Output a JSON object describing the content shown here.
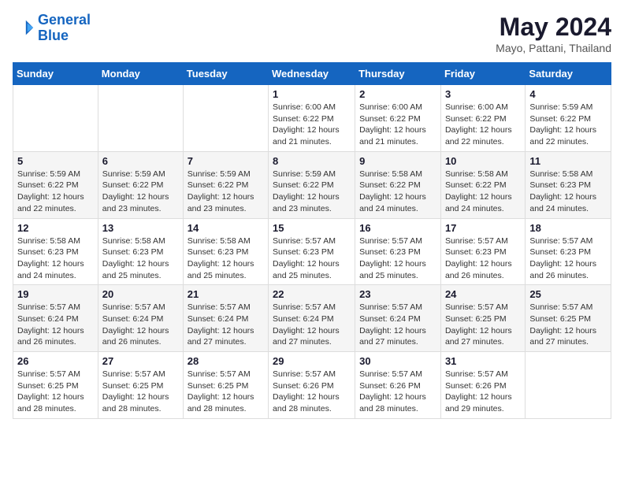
{
  "header": {
    "logo_line1": "General",
    "logo_line2": "Blue",
    "main_title": "May 2024",
    "subtitle": "Mayo, Pattani, Thailand"
  },
  "weekdays": [
    "Sunday",
    "Monday",
    "Tuesday",
    "Wednesday",
    "Thursday",
    "Friday",
    "Saturday"
  ],
  "weeks": [
    [
      {
        "day": "",
        "info": ""
      },
      {
        "day": "",
        "info": ""
      },
      {
        "day": "",
        "info": ""
      },
      {
        "day": "1",
        "info": "Sunrise: 6:00 AM\nSunset: 6:22 PM\nDaylight: 12 hours\nand 21 minutes."
      },
      {
        "day": "2",
        "info": "Sunrise: 6:00 AM\nSunset: 6:22 PM\nDaylight: 12 hours\nand 21 minutes."
      },
      {
        "day": "3",
        "info": "Sunrise: 6:00 AM\nSunset: 6:22 PM\nDaylight: 12 hours\nand 22 minutes."
      },
      {
        "day": "4",
        "info": "Sunrise: 5:59 AM\nSunset: 6:22 PM\nDaylight: 12 hours\nand 22 minutes."
      }
    ],
    [
      {
        "day": "5",
        "info": "Sunrise: 5:59 AM\nSunset: 6:22 PM\nDaylight: 12 hours\nand 22 minutes."
      },
      {
        "day": "6",
        "info": "Sunrise: 5:59 AM\nSunset: 6:22 PM\nDaylight: 12 hours\nand 23 minutes."
      },
      {
        "day": "7",
        "info": "Sunrise: 5:59 AM\nSunset: 6:22 PM\nDaylight: 12 hours\nand 23 minutes."
      },
      {
        "day": "8",
        "info": "Sunrise: 5:59 AM\nSunset: 6:22 PM\nDaylight: 12 hours\nand 23 minutes."
      },
      {
        "day": "9",
        "info": "Sunrise: 5:58 AM\nSunset: 6:22 PM\nDaylight: 12 hours\nand 24 minutes."
      },
      {
        "day": "10",
        "info": "Sunrise: 5:58 AM\nSunset: 6:22 PM\nDaylight: 12 hours\nand 24 minutes."
      },
      {
        "day": "11",
        "info": "Sunrise: 5:58 AM\nSunset: 6:23 PM\nDaylight: 12 hours\nand 24 minutes."
      }
    ],
    [
      {
        "day": "12",
        "info": "Sunrise: 5:58 AM\nSunset: 6:23 PM\nDaylight: 12 hours\nand 24 minutes."
      },
      {
        "day": "13",
        "info": "Sunrise: 5:58 AM\nSunset: 6:23 PM\nDaylight: 12 hours\nand 25 minutes."
      },
      {
        "day": "14",
        "info": "Sunrise: 5:58 AM\nSunset: 6:23 PM\nDaylight: 12 hours\nand 25 minutes."
      },
      {
        "day": "15",
        "info": "Sunrise: 5:57 AM\nSunset: 6:23 PM\nDaylight: 12 hours\nand 25 minutes."
      },
      {
        "day": "16",
        "info": "Sunrise: 5:57 AM\nSunset: 6:23 PM\nDaylight: 12 hours\nand 25 minutes."
      },
      {
        "day": "17",
        "info": "Sunrise: 5:57 AM\nSunset: 6:23 PM\nDaylight: 12 hours\nand 26 minutes."
      },
      {
        "day": "18",
        "info": "Sunrise: 5:57 AM\nSunset: 6:23 PM\nDaylight: 12 hours\nand 26 minutes."
      }
    ],
    [
      {
        "day": "19",
        "info": "Sunrise: 5:57 AM\nSunset: 6:24 PM\nDaylight: 12 hours\nand 26 minutes."
      },
      {
        "day": "20",
        "info": "Sunrise: 5:57 AM\nSunset: 6:24 PM\nDaylight: 12 hours\nand 26 minutes."
      },
      {
        "day": "21",
        "info": "Sunrise: 5:57 AM\nSunset: 6:24 PM\nDaylight: 12 hours\nand 27 minutes."
      },
      {
        "day": "22",
        "info": "Sunrise: 5:57 AM\nSunset: 6:24 PM\nDaylight: 12 hours\nand 27 minutes."
      },
      {
        "day": "23",
        "info": "Sunrise: 5:57 AM\nSunset: 6:24 PM\nDaylight: 12 hours\nand 27 minutes."
      },
      {
        "day": "24",
        "info": "Sunrise: 5:57 AM\nSunset: 6:25 PM\nDaylight: 12 hours\nand 27 minutes."
      },
      {
        "day": "25",
        "info": "Sunrise: 5:57 AM\nSunset: 6:25 PM\nDaylight: 12 hours\nand 27 minutes."
      }
    ],
    [
      {
        "day": "26",
        "info": "Sunrise: 5:57 AM\nSunset: 6:25 PM\nDaylight: 12 hours\nand 28 minutes."
      },
      {
        "day": "27",
        "info": "Sunrise: 5:57 AM\nSunset: 6:25 PM\nDaylight: 12 hours\nand 28 minutes."
      },
      {
        "day": "28",
        "info": "Sunrise: 5:57 AM\nSunset: 6:25 PM\nDaylight: 12 hours\nand 28 minutes."
      },
      {
        "day": "29",
        "info": "Sunrise: 5:57 AM\nSunset: 6:26 PM\nDaylight: 12 hours\nand 28 minutes."
      },
      {
        "day": "30",
        "info": "Sunrise: 5:57 AM\nSunset: 6:26 PM\nDaylight: 12 hours\nand 28 minutes."
      },
      {
        "day": "31",
        "info": "Sunrise: 5:57 AM\nSunset: 6:26 PM\nDaylight: 12 hours\nand 29 minutes."
      },
      {
        "day": "",
        "info": ""
      }
    ]
  ]
}
